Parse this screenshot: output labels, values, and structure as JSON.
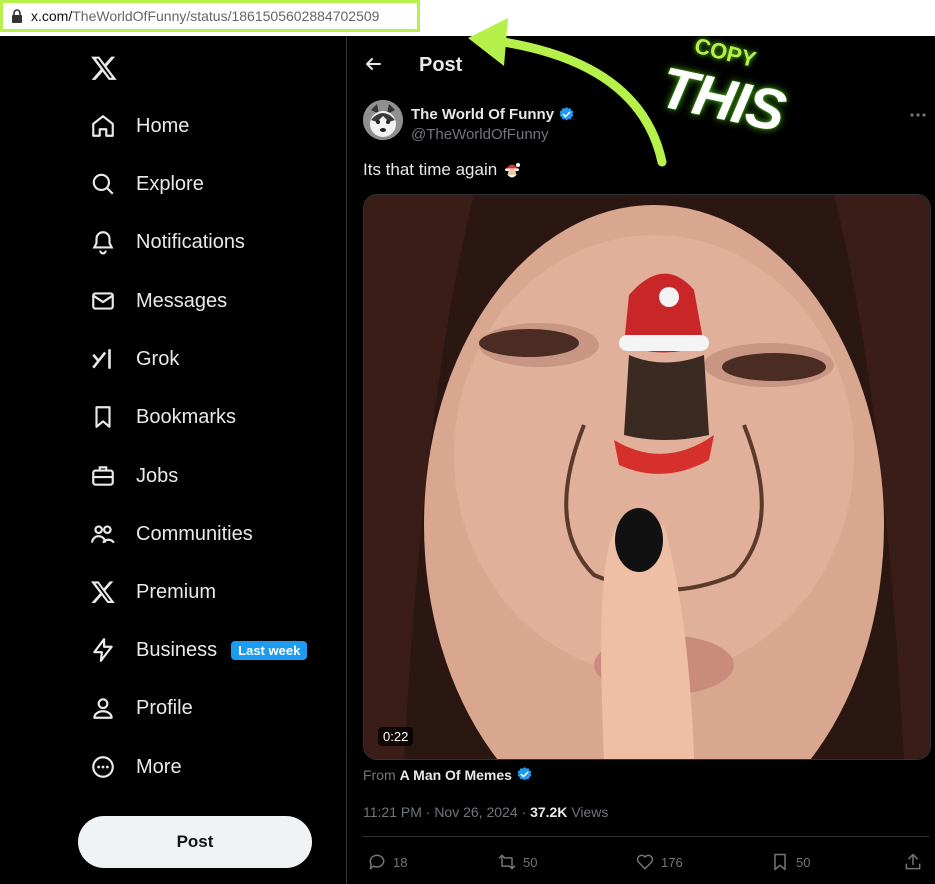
{
  "browser": {
    "url_host": "x.com/",
    "url_path": "TheWorldOfFunny/status/1861505602884702509"
  },
  "sidebar": {
    "items": [
      {
        "label": "Home",
        "icon": "home-icon"
      },
      {
        "label": "Explore",
        "icon": "search-icon"
      },
      {
        "label": "Notifications",
        "icon": "bell-icon"
      },
      {
        "label": "Messages",
        "icon": "envelope-icon"
      },
      {
        "label": "Grok",
        "icon": "grok-icon"
      },
      {
        "label": "Bookmarks",
        "icon": "bookmark-icon"
      },
      {
        "label": "Jobs",
        "icon": "briefcase-icon"
      },
      {
        "label": "Communities",
        "icon": "people-icon"
      },
      {
        "label": "Premium",
        "icon": "x-logo-icon"
      },
      {
        "label": "Business",
        "icon": "lightning-icon",
        "badge": "Last week"
      },
      {
        "label": "Profile",
        "icon": "person-icon"
      },
      {
        "label": "More",
        "icon": "more-circle-icon"
      }
    ],
    "post_button": "Post"
  },
  "header": {
    "title": "Post"
  },
  "post": {
    "author_name": "The World Of Funny",
    "author_handle": "@TheWorldOfFunny",
    "text": "Its that time again",
    "video_duration": "0:22",
    "from_prefix": "From",
    "from_source": "A Man Of Memes",
    "timestamp": "11:21 PM · Nov 26, 2024 ·",
    "views_count": "37.2K",
    "views_label": "Views",
    "replies": "18",
    "reposts": "50",
    "likes": "176",
    "bookmarks": "50"
  },
  "annotation": {
    "line1": "COPY",
    "line2": "THIS",
    "color": "#b6f04a"
  },
  "colors": {
    "accent": "#1d9bf0",
    "text": "#e7e9ea",
    "muted": "#71767b",
    "highlight": "#b6f04a"
  }
}
